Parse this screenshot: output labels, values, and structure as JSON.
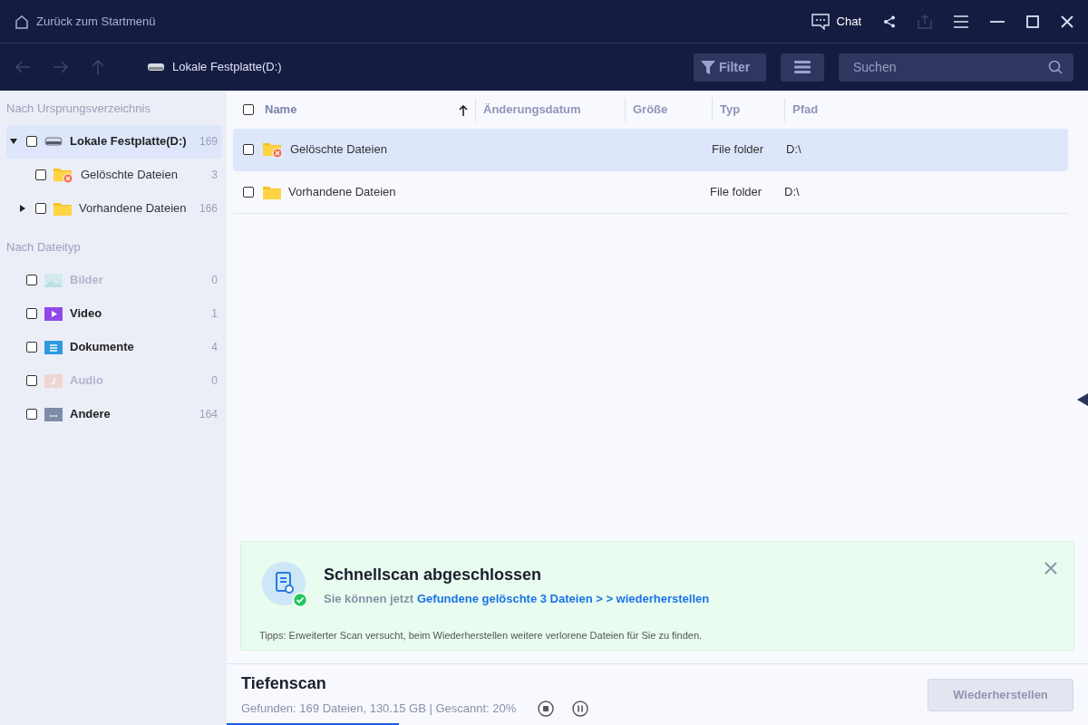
{
  "titlebar": {
    "back_label": "Zurück zum Startmenü",
    "chat_label": "Chat",
    "share_disabled": true
  },
  "toolbar": {
    "location": "Lokale Festplatte(D:)",
    "filter_label": "Filter",
    "search": {
      "placeholder": "Suchen"
    }
  },
  "sidebar": {
    "sections": [
      {
        "title": "Nach Ursprungsverzeichnis",
        "items": [
          {
            "kind": "drive",
            "label": "Lokale Festplatte(D:)",
            "count": "169",
            "checked": false,
            "selected": true,
            "expanded": true,
            "disabled": false,
            "children": [
              {
                "kind": "deleted",
                "label": "Gelöschte Dateien",
                "count": "3",
                "checked": false,
                "selected": false,
                "disabled": false
              },
              {
                "kind": "folder",
                "label": "Vorhandene Dateien",
                "count": "166",
                "checked": false,
                "selected": false,
                "expanded": false,
                "disabled": false
              }
            ]
          }
        ]
      },
      {
        "title": "Nach Dateityp",
        "items": [
          {
            "kind": "images",
            "label": "Bilder",
            "count": "0",
            "checked": false,
            "selected": false,
            "disabled": true
          },
          {
            "kind": "video",
            "label": "Video",
            "count": "1",
            "checked": false,
            "selected": false,
            "disabled": false
          },
          {
            "kind": "documents",
            "label": "Dokumente",
            "count": "4",
            "checked": false,
            "selected": false,
            "disabled": false
          },
          {
            "kind": "audio",
            "label": "Audio",
            "count": "0",
            "checked": false,
            "selected": false,
            "disabled": true
          },
          {
            "kind": "other",
            "label": "Andere",
            "count": "164",
            "checked": false,
            "selected": false,
            "disabled": false
          }
        ]
      }
    ]
  },
  "table": {
    "all_checked": false,
    "columns": [
      {
        "label": "Name",
        "sorted": true
      },
      {
        "label": "Änderungsdatum",
        "sorted": false
      },
      {
        "label": "Größe",
        "sorted": false
      },
      {
        "label": "Typ",
        "sorted": false
      },
      {
        "label": "Pfad",
        "sorted": false
      }
    ],
    "rows": [
      {
        "kind": "deleted",
        "name": "Gelöschte Dateien",
        "type": "File folder",
        "path": "D:\\",
        "checked": false,
        "selected": true
      },
      {
        "kind": "folder",
        "name": "Vorhandene Dateien",
        "type": "File folder",
        "path": "D:\\",
        "checked": false,
        "selected": false
      }
    ]
  },
  "notice": {
    "title": "Schnellscan abgeschlossen",
    "text": "Sie können jetzt",
    "link": "Gefundene gelöschte 3 Dateien > > wiederherstellen",
    "tip": "Tipps: Erweiterter Scan versucht, beim Wiederherstellen weitere verlorene Dateien für Sie zu finden."
  },
  "footer": {
    "title": "Tiefenscan",
    "status": "Gefunden: 169 Dateien, 130.15 GB | Gescannt: 20%",
    "level": 0.2,
    "button": {
      "label": "Wiederherstellen",
      "disabled": true
    }
  }
}
